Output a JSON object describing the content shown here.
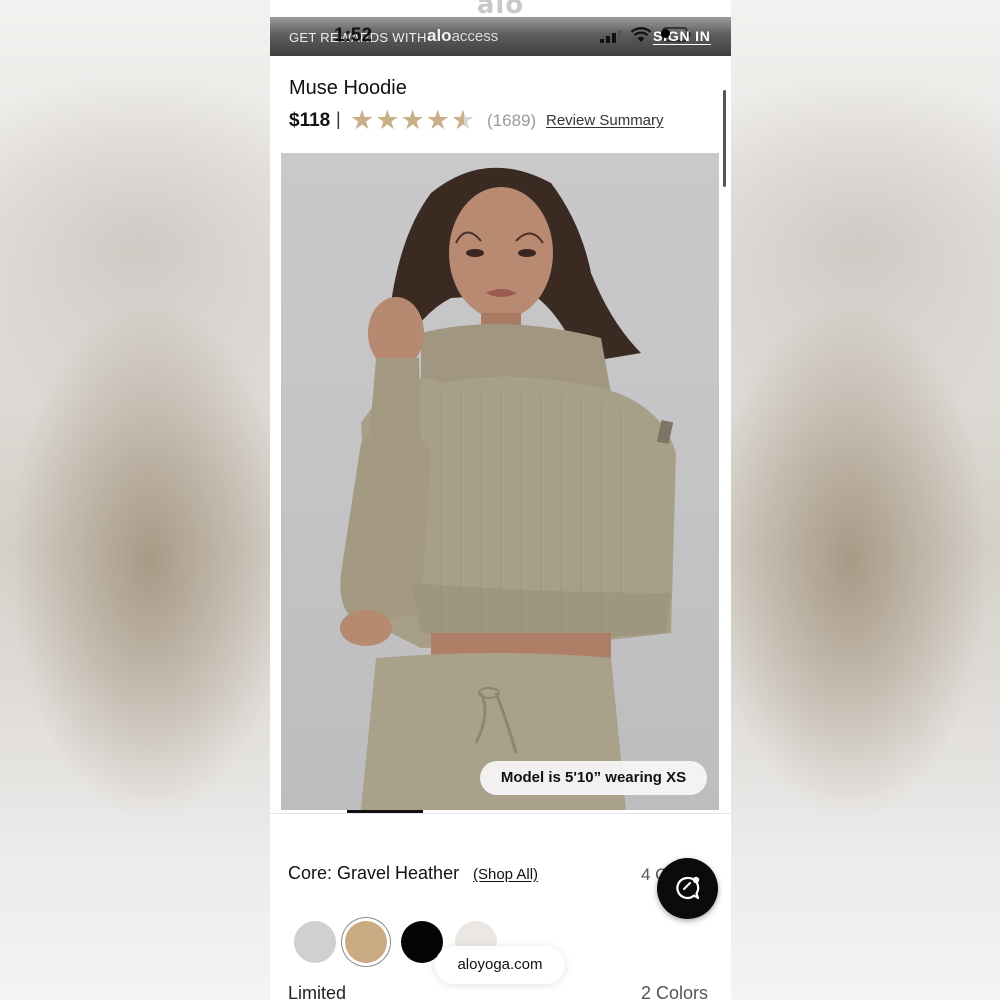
{
  "status_bar": {
    "time": "1:52",
    "icons": [
      "signal-icon",
      "wifi-icon",
      "battery-icon"
    ]
  },
  "header": {
    "logo_text": "alo"
  },
  "promo": {
    "text": "GET REWARDS WITH",
    "brand_alo": "alo",
    "brand_access": "access",
    "sign_in": "SIGN IN"
  },
  "product": {
    "name": "Muse Hoodie",
    "price": "$118",
    "separator": "|",
    "rating_value": 4.5,
    "rating_max": 5,
    "review_count": "(1689)",
    "review_summary_link": "Review Summary",
    "model_info": "Model is 5'10” wearing XS"
  },
  "color": {
    "label": "Core: Gravel Heather",
    "shop_all": "(Shop All)",
    "count_partial": "4 C",
    "swatches": [
      {
        "name": "light-grey",
        "hex": "#d0d0d0"
      },
      {
        "name": "gravel-heather",
        "hex": "#c9aa82",
        "selected": true
      },
      {
        "name": "black",
        "hex": "#050505"
      },
      {
        "name": "ivory",
        "hex": "#ebe8e3"
      }
    ],
    "limited_label": "Limited",
    "limited_count": "2 Colors"
  },
  "browser": {
    "url": "aloyoga.com"
  },
  "colors": {
    "star": "#c8b08a",
    "promo_bg": "#4a4a4a"
  }
}
